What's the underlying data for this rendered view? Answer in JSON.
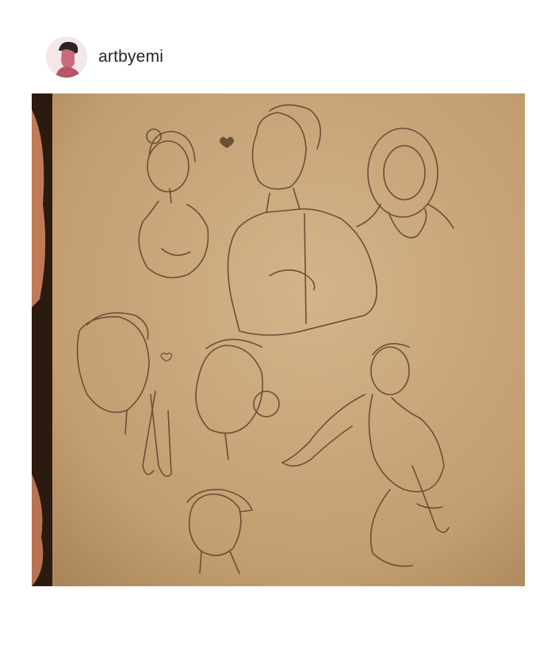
{
  "post": {
    "username": "artbyemi",
    "avatar_icon": "profile-avatar-icon",
    "image_description_icon": "sketch-page-image",
    "tag_button_icon": "person-icon"
  },
  "colors": {
    "paper": "#c8a77a",
    "pencil": "#6b4f36",
    "frame_dark": "#2b1a10",
    "tag_button": "#1e1e1e"
  }
}
